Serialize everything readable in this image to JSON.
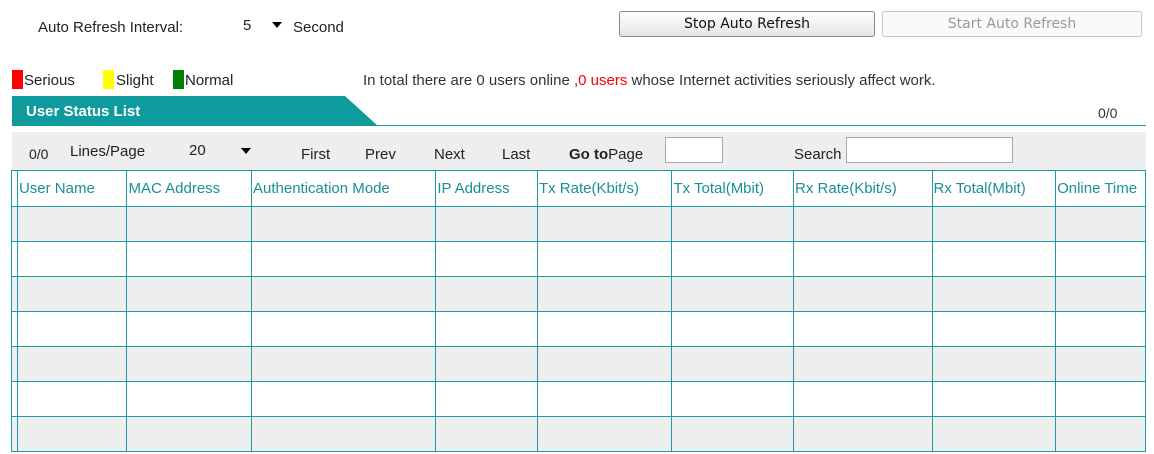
{
  "refresh": {
    "interval_label": "Auto Refresh Interval:",
    "interval_value": "5",
    "interval_unit": "Second",
    "stop_label": "Stop Auto Refresh",
    "start_label": "Start Auto Refresh"
  },
  "legend": {
    "serious": "Serious",
    "slight": "Slight",
    "normal": "Normal",
    "colors": {
      "serious": "#ff0000",
      "slight": "#ffff00",
      "normal": "#008000"
    }
  },
  "summary": {
    "part1": "In total there are 0 users online ,",
    "highlight": "0 users",
    "part2": " whose Internet activities seriously affect work."
  },
  "list": {
    "title": "User Status List",
    "page_count": "0/0"
  },
  "toolbar": {
    "count": "0/0",
    "lines_label": "Lines/Page",
    "lines_value": "20",
    "first": "First",
    "prev": "Prev",
    "next": "Next",
    "last": "Last",
    "goto_bold": "Go to",
    "goto_page": "Page",
    "goto_value": "",
    "search_label": "Search",
    "search_value": ""
  },
  "table": {
    "columns": [
      "User Name",
      "MAC Address",
      "Authentication Mode",
      "IP Address",
      "Tx Rate(Kbit/s)",
      "Tx Total(Mbit)",
      "Rx Rate(Kbit/s)",
      "Rx Total(Mbit)",
      "Online Time"
    ]
  },
  "colors": {
    "accent": "#1a9ea2",
    "header_text": "#1a8f95",
    "title_bg": "#0f9a9e"
  }
}
